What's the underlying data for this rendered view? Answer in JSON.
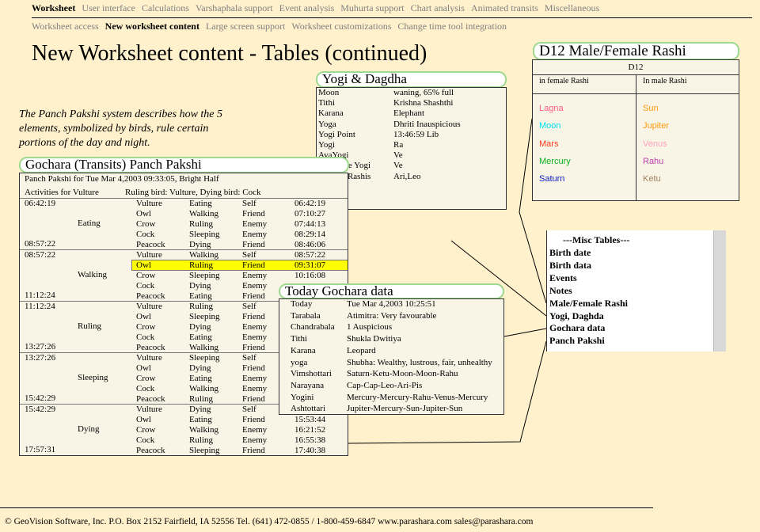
{
  "nav": {
    "primary": [
      "Worksheet",
      "User interface",
      "Calculations",
      "Varshaphala support",
      "Event analysis",
      "Muhurta support",
      "Chart analysis",
      "Animated transits",
      "Miscellaneous"
    ],
    "primary_active": 0,
    "secondary": [
      "Worksheet access",
      "New worksheet content",
      "Large screen support",
      "Worksheet customizations",
      "Change time tool integration"
    ],
    "secondary_active": 1
  },
  "page_title": "New Worksheet content - Tables (continued)",
  "intro": [
    "The Panch Pakshi system describes how the 5",
    "elements, symbolized by birds, rule certain",
    "portions of the day and night."
  ],
  "panch": {
    "title": "Gochara (Transits) Panch Pakshi",
    "header": "Panch Pakshi for Tue Mar 4,2003   09:33:05,  Bright Half",
    "activities_label": "Activities for Vulture",
    "ruling": "Ruling bird: Vulture,  Dying bird: Cock",
    "blocks": [
      {
        "start": "06:42:19",
        "end": "08:57:22",
        "activity": "Eating",
        "rows": [
          [
            "Vulture",
            "Eating",
            "Self",
            "06:42:19"
          ],
          [
            "Owl",
            "Walking",
            "Friend",
            "07:10:27"
          ],
          [
            "Crow",
            "Ruling",
            "Enemy",
            "07:44:13"
          ],
          [
            "Cock",
            "Sleeping",
            "Enemy",
            "08:29:14"
          ],
          [
            "Peacock",
            "Dying",
            "Friend",
            "08:46:06"
          ]
        ]
      },
      {
        "start": "08:57:22",
        "end": "11:12:24",
        "activity": "Walking",
        "rows": [
          [
            "Vulture",
            "Walking",
            "Self",
            "08:57:22"
          ],
          [
            "Owl",
            "Ruling",
            "Friend",
            "09:31:07"
          ],
          [
            "Crow",
            "Sleeping",
            "Enemy",
            "10:16:08"
          ],
          [
            "Cock",
            "Dying",
            "Enemy",
            ""
          ],
          [
            "Peacock",
            "Eating",
            "Friend",
            ""
          ]
        ]
      },
      {
        "start": "11:12:24",
        "end": "13:27:26",
        "activity": "Ruling",
        "rows": [
          [
            "Vulture",
            "Ruling",
            "Self",
            ""
          ],
          [
            "Owl",
            "Sleeping",
            "Friend",
            ""
          ],
          [
            "Crow",
            "Dying",
            "Enemy",
            ""
          ],
          [
            "Cock",
            "Eating",
            "Enemy",
            ""
          ],
          [
            "Peacock",
            "Walking",
            "Friend",
            ""
          ]
        ]
      },
      {
        "start": "13:27:26",
        "end": "15:42:29",
        "activity": "Sleeping",
        "rows": [
          [
            "Vulture",
            "Sleeping",
            "Self",
            ""
          ],
          [
            "Owl",
            "Dying",
            "Friend",
            ""
          ],
          [
            "Crow",
            "Eating",
            "Enemy",
            ""
          ],
          [
            "Cock",
            "Walking",
            "Enemy",
            ""
          ],
          [
            "Peacock",
            "Ruling",
            "Friend",
            ""
          ]
        ]
      },
      {
        "start": "15:42:29",
        "end": "17:57:31",
        "activity": "Dying",
        "rows": [
          [
            "Vulture",
            "Dying",
            "Self",
            ""
          ],
          [
            "Owl",
            "Eating",
            "Friend",
            "15:53:44"
          ],
          [
            "Crow",
            "Walking",
            "Enemy",
            "16:21:52"
          ],
          [
            "Cock",
            "Ruling",
            "Enemy",
            "16:55:38"
          ],
          [
            "Peacock",
            "Sleeping",
            "Friend",
            "17:40:38"
          ]
        ]
      }
    ],
    "highlight_color": "#ffff00"
  },
  "yogi": {
    "title": "Yogi & Dagdha",
    "rows": [
      [
        "Moon",
        "waning, 65% full"
      ],
      [
        "Tithi",
        "Krishna  Shashthi"
      ],
      [
        "Karana",
        "Elephant"
      ],
      [
        "Yoga",
        "Dhriti Inauspicious"
      ],
      [
        "Yogi Point",
        "13:46:59 Lib"
      ],
      [
        "Yogi",
        "Ra"
      ],
      [
        "AvaYogi",
        "Ve"
      ],
      [
        "Duplicate Yogi",
        "Ve"
      ],
      [
        "Dagdha Rashis",
        "Ari,Leo"
      ]
    ]
  },
  "gochara": {
    "title": "Today Gochara data",
    "rows": [
      [
        "Today",
        "Tue Mar 4,2003   10:25:51"
      ],
      [
        "Tarabala",
        "Atimitra: Very favourable"
      ],
      [
        "Chandrabala",
        "1 Auspicious"
      ],
      [
        "Tithi",
        "Shukla  Dwitiya"
      ],
      [
        "Karana",
        "Leopard"
      ],
      [
        "yoga",
        "Shubha: Wealthy, lustrous, fair, unhealthy"
      ],
      [
        "Vimshottari",
        "Saturn-Ketu-Moon-Moon-Rahu"
      ],
      [
        "Narayana",
        "Cap-Cap-Leo-Ari-Pis"
      ],
      [
        "Yogini",
        "Mercury-Mercury-Rahu-Venus-Mercury"
      ],
      [
        "Ashtottari",
        "Jupiter-Mercury-Sun-Jupiter-Sun"
      ]
    ]
  },
  "d12": {
    "title": "D12  Male/Female Rashi",
    "header": "D12",
    "col1": "in female Rashi",
    "col2": "In male Rashi",
    "female": [
      {
        "name": "Lagna",
        "color": "#ff5f7f"
      },
      {
        "name": "Moon",
        "color": "#00e0f0"
      },
      {
        "name": "Mars",
        "color": "#ff3a1a"
      },
      {
        "name": "Mercury",
        "color": "#10b020"
      },
      {
        "name": "Saturn",
        "color": "#1020c0"
      }
    ],
    "male": [
      {
        "name": "Sun",
        "color": "#ff9a10"
      },
      {
        "name": "Jupiter",
        "color": "#ff9a10"
      },
      {
        "name": "Venus",
        "color": "#ffa0c0"
      },
      {
        "name": "Rahu",
        "color": "#c040b0"
      },
      {
        "name": "Ketu",
        "color": "#a08060"
      }
    ]
  },
  "misc": {
    "header": "---Misc Tables---",
    "items": [
      "Birth date",
      "Birth data",
      "Events",
      "Notes",
      "Male/Female Rashi",
      "Yogi, Daghda",
      "Gochara data",
      "Panch Pakshi"
    ]
  },
  "footer": "© GeoVision Software, Inc. P.O. Box 2152 Fairfield, IA 52556     Tel. (641) 472-0855 / 1-800-459-6847     www.parashara.com     sales@parashara.com"
}
